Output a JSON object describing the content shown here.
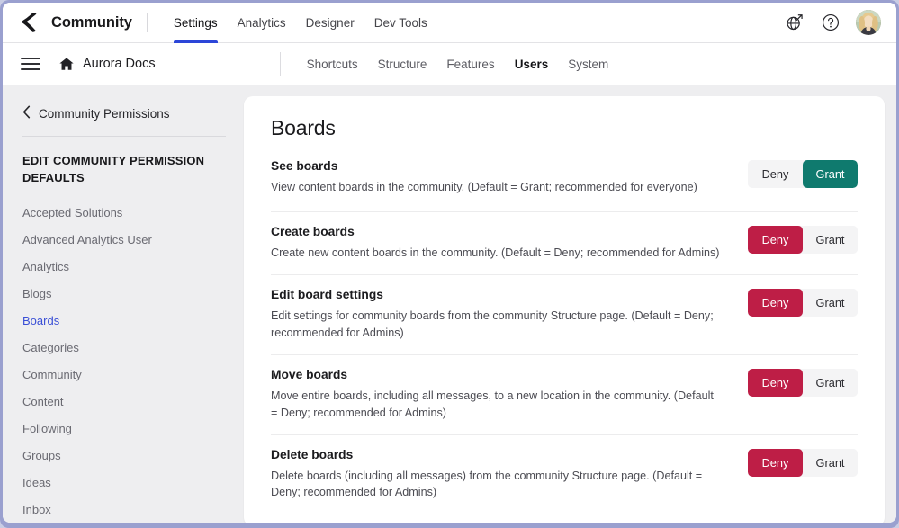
{
  "topbar": {
    "logo_icon": "khoros-chevron-logo",
    "brand": "Community",
    "nav": [
      {
        "label": "Settings",
        "active": true
      },
      {
        "label": "Analytics",
        "active": false
      },
      {
        "label": "Designer",
        "active": false
      },
      {
        "label": "Dev Tools",
        "active": false
      }
    ],
    "actions": [
      {
        "icon": "globe-external-link-icon",
        "name": "visit-community-icon"
      },
      {
        "icon": "help-circle-icon",
        "name": "help-icon"
      }
    ],
    "avatar_name": "user-avatar"
  },
  "subbar": {
    "menu_icon": "hamburger-menu-icon",
    "home_icon": "home-icon",
    "site_name": "Aurora Docs",
    "nav": [
      {
        "label": "Shortcuts",
        "active": false
      },
      {
        "label": "Structure",
        "active": false
      },
      {
        "label": "Features",
        "active": false
      },
      {
        "label": "Users",
        "active": true
      },
      {
        "label": "System",
        "active": false
      }
    ]
  },
  "sidebar": {
    "back_icon": "chevron-left-icon",
    "back_label": "Community Permissions",
    "section_title": "EDIT COMMUNITY PERMISSION DEFAULTS",
    "items": [
      {
        "label": "Accepted Solutions",
        "active": false
      },
      {
        "label": "Advanced Analytics User",
        "active": false
      },
      {
        "label": "Analytics",
        "active": false
      },
      {
        "label": "Blogs",
        "active": false
      },
      {
        "label": "Boards",
        "active": true
      },
      {
        "label": "Categories",
        "active": false
      },
      {
        "label": "Community",
        "active": false
      },
      {
        "label": "Content",
        "active": false
      },
      {
        "label": "Following",
        "active": false
      },
      {
        "label": "Groups",
        "active": false
      },
      {
        "label": "Ideas",
        "active": false
      },
      {
        "label": "Inbox",
        "active": false
      }
    ]
  },
  "main": {
    "title": "Boards",
    "deny_label": "Deny",
    "grant_label": "Grant",
    "permissions": [
      {
        "name": "See boards",
        "description": "View content boards in the community. (Default = Grant; recommended for everyone)",
        "selected": "grant"
      },
      {
        "name": "Create boards",
        "description": "Create new content boards in the community. (Default = Deny; recommended for Admins)",
        "selected": "deny"
      },
      {
        "name": "Edit board settings",
        "description": "Edit settings for community boards from the community Structure page. (Default = Deny; recommended for Admins)",
        "selected": "deny"
      },
      {
        "name": "Move boards",
        "description": "Move entire boards, including all messages, to a new location in the community. (Default = Deny; recommended for Admins)",
        "selected": "deny"
      },
      {
        "name": "Delete boards",
        "description": "Delete boards (including all messages) from the community Structure page. (Default = Deny; recommended for Admins)",
        "selected": "deny"
      }
    ]
  },
  "colors": {
    "accent_blue": "#2c46d8",
    "link_blue": "#3a4fd6",
    "deny_red": "#be1e46",
    "grant_teal": "#0f7a6e",
    "page_bg": "#eeeef0"
  }
}
